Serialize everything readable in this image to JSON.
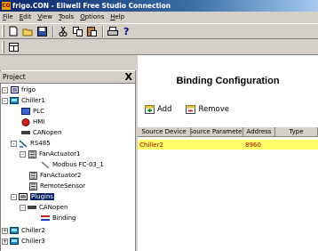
{
  "window": {
    "title": "frigo.CON - Eliwell Free Studio Connection",
    "app_icon_text": "CO"
  },
  "menu": [
    {
      "label": "File",
      "key": "F",
      "rest": "ile"
    },
    {
      "label": "Edit",
      "key": "E",
      "rest": "dit"
    },
    {
      "label": "View",
      "key": "V",
      "rest": "iew"
    },
    {
      "label": "Tools",
      "key": "T",
      "rest": "ools"
    },
    {
      "label": "Options",
      "key": "O",
      "rest": "ptions"
    },
    {
      "label": "Help",
      "key": "H",
      "rest": "elp"
    }
  ],
  "toolbar": {
    "buttons": [
      "new-icon",
      "open-icon",
      "save-icon",
      "cut-icon",
      "copy-icon",
      "paste-icon",
      "print-icon",
      "help-icon"
    ],
    "layout_button": "layout-icon"
  },
  "project_panel": {
    "title": "Project",
    "close_label": "X",
    "tree": [
      {
        "label": "frigo",
        "icon": "project-icon",
        "expander": "-"
      },
      {
        "label": "Chiller1",
        "icon": "device-icon",
        "expander": "-"
      },
      {
        "label": "PLC",
        "icon": "plc-icon",
        "expander": ""
      },
      {
        "label": "HMI",
        "icon": "hmi-icon",
        "expander": ""
      },
      {
        "label": "CANopen",
        "icon": "can-icon",
        "expander": ""
      },
      {
        "label": "RS485",
        "icon": "rs485-icon",
        "expander": "-"
      },
      {
        "label": "FanActuator1",
        "icon": "fan-icon",
        "expander": "-"
      },
      {
        "label": "Modbus FC-03_1",
        "icon": "modbus-icon",
        "expander": ""
      },
      {
        "label": "FanActuator2",
        "icon": "fan-icon",
        "expander": ""
      },
      {
        "label": "RemoteSensor",
        "icon": "sensor-icon",
        "expander": ""
      },
      {
        "label": "Plugins",
        "icon": "plugins-icon",
        "expander": "-",
        "selected": true
      },
      {
        "label": "CANopen",
        "icon": "can-icon",
        "expander": "-"
      },
      {
        "label": "Binding",
        "icon": "binding-icon",
        "expander": ""
      },
      {
        "label": "Chiller2",
        "icon": "device-icon",
        "expander": "+"
      },
      {
        "label": "Chiller3",
        "icon": "device-icon",
        "expander": "+"
      }
    ]
  },
  "binding": {
    "title": "Binding Configuration",
    "add_label": "Add",
    "remove_label": "Remove",
    "columns": [
      "Source Device",
      "Source Parameter",
      "Address",
      "Type"
    ],
    "rows": [
      {
        "source_device": "Chiller2",
        "source_parameter": "",
        "address": "8960",
        "type": ""
      }
    ]
  },
  "colors": {
    "selected_row": "#ffff66",
    "title_gradient_start": "#0a246a",
    "row_text": "#b00000"
  }
}
